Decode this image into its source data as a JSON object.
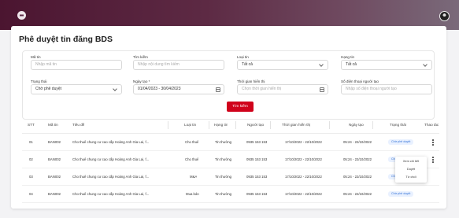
{
  "app": {
    "title": "Phê duyệt tin đăng BDS",
    "menu_icon": "menu-icon",
    "avatar_icon": "user-avatar"
  },
  "filters": {
    "ma_tin": {
      "label": "Mã tin",
      "placeholder": "Nhập mã tin"
    },
    "tim_kiem": {
      "label": "Tìm kiếm",
      "placeholder": "Nhập nội dung tìm kiếm"
    },
    "loai_tin": {
      "label": "Loại tin",
      "value": "Tất cả"
    },
    "hang_tin": {
      "label": "Hạng tin",
      "value": "Tất cả"
    },
    "trang_thai": {
      "label": "Trạng thái",
      "value": "Chờ phê duyệt"
    },
    "ngay_tao": {
      "label": "Ngày tạo *",
      "value": "01/04/2023 - 30/04/2023"
    },
    "thoi_gian_hien_thi": {
      "label": "Thời gian hiển thị",
      "placeholder": "Chọn thời gian hiển thị"
    },
    "so_dien_thoai": {
      "label": "Số điện thoại người tạo",
      "placeholder": "Nhập số điện thoại người tạo"
    },
    "search_button": "Tìm kiếm"
  },
  "table": {
    "headers": [
      "STT",
      "Mã tin",
      "Tiêu đề",
      "Loại tin",
      "Hạng tin",
      "Người tạo",
      "Thời gian hiển thị",
      "Ngày tạo",
      "Trạng thái",
      "Thao tác"
    ],
    "rows": [
      [
        "01",
        "BAN002",
        "Cho thuê chung cư cao cấp Hoàng Anh Gia Lai, f...",
        "Cho thuê",
        "Tin thường",
        "0935 153 153",
        "17/10/2022 - 22/10/2022",
        "05:24 - 22/10/2022",
        "Chờ phê duyệt"
      ],
      [
        "02",
        "BAN002",
        "Cho thuê chung cư cao cấp Hoàng Anh Gia Lai, f...",
        "Cho thuê",
        "Tin thường",
        "0935 153 153",
        "17/10/2022 - 22/10/2022",
        "05:24 - 22/10/2022",
        "Chờ phê duyệt"
      ],
      [
        "03",
        "BAN002",
        "Cho thuê chung cư cao cấp Hoàng Anh Gia Lai, f...",
        "M&A",
        "Tin thường",
        "0935 153 153",
        "17/10/2022 - 22/10/2022",
        "05:24 - 22/10/2022",
        "Chờ phê duyệt"
      ],
      [
        "04",
        "BAN002",
        "Cho thuê chung cư cao cấp Hoàng Anh Gia Lai, f...",
        "Mua bán",
        "Tin thường",
        "0935 153 153",
        "17/10/2022 - 22/10/2022",
        "05:24 - 22/10/2022",
        "Chờ phê duyệt"
      ]
    ]
  },
  "action_menu": [
    "Xem chi tiết",
    "Duyệt",
    "Từ chối"
  ],
  "colors": {
    "primary": "#d0021b",
    "badge_text": "#2f6fd6",
    "badge_bg": "#e9f1ff",
    "topbar": "#4b1530"
  }
}
